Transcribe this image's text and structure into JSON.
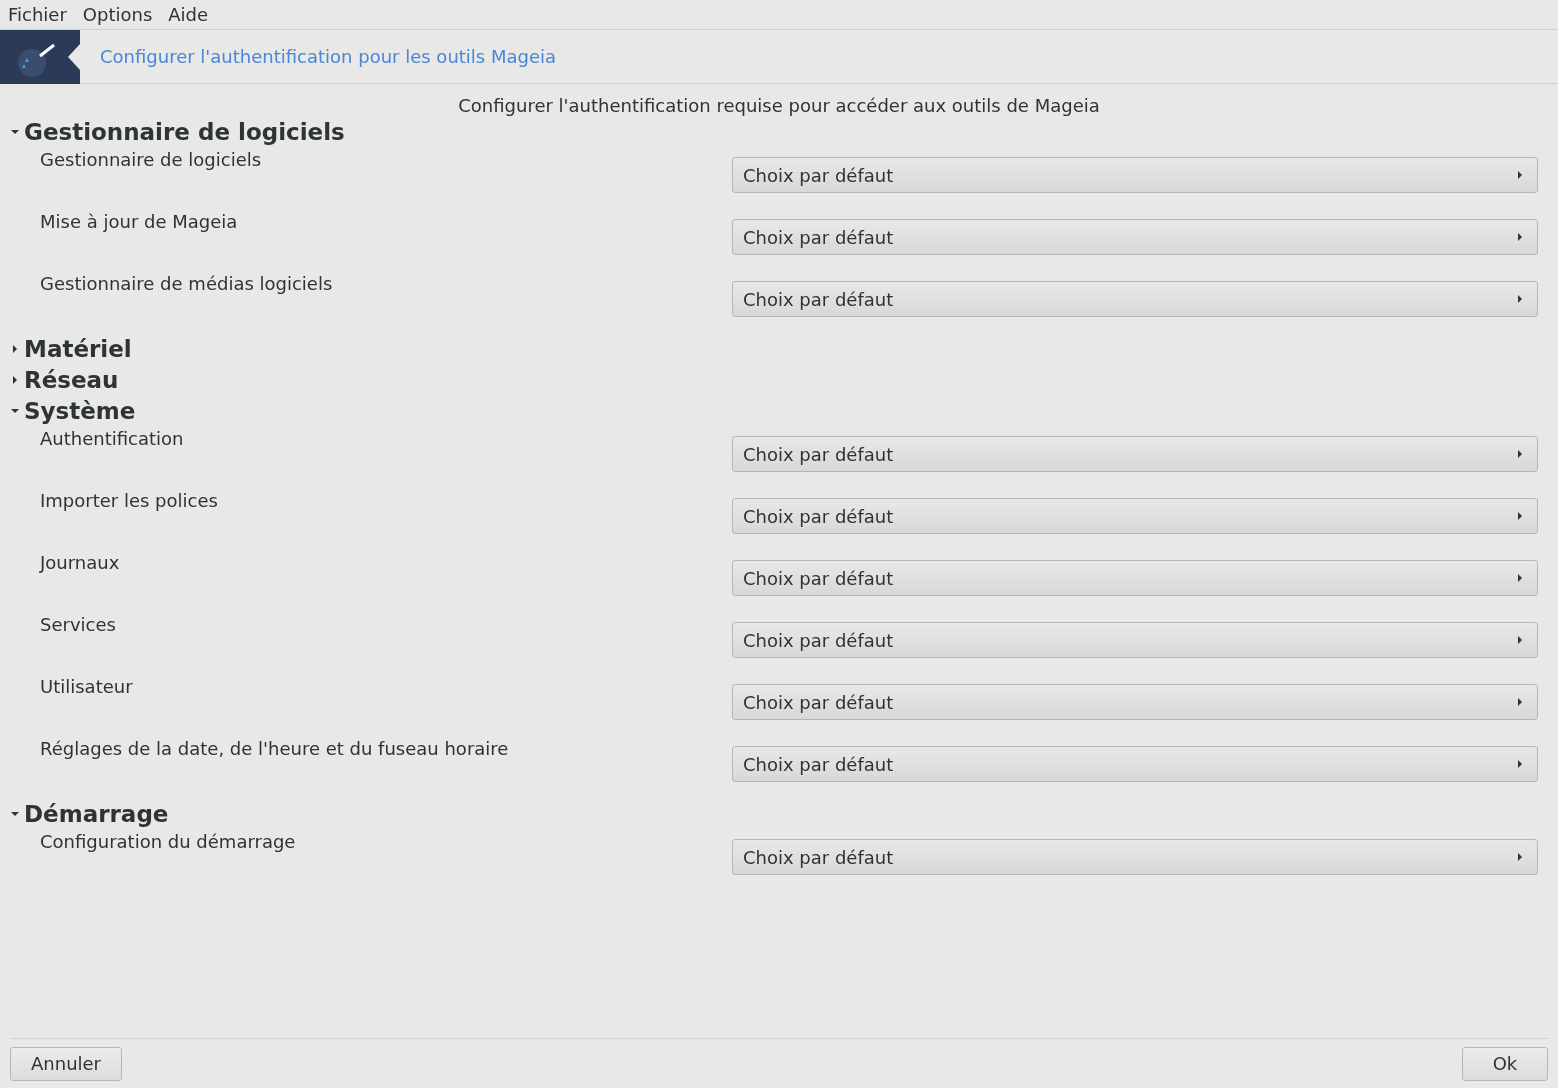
{
  "menu_bar": [
    "Fichier",
    "Options",
    "Aide"
  ],
  "header": {
    "title": "Configurer l'authentification pour les outils Mageia"
  },
  "subtitle": "Configurer l'authentification requise pour accéder aux outils de Mageia",
  "sections": [
    {
      "title": "Gestionnaire de logiciels",
      "expanded": true,
      "items": [
        {
          "label": "Gestionnaire de logiciels",
          "value": "Choix par défaut"
        },
        {
          "label": "Mise à jour de Mageia",
          "value": "Choix par défaut"
        },
        {
          "label": "Gestionnaire de médias logiciels",
          "value": "Choix par défaut"
        }
      ]
    },
    {
      "title": "Matériel",
      "expanded": false
    },
    {
      "title": "Réseau",
      "expanded": false
    },
    {
      "title": "Système",
      "expanded": true,
      "items": [
        {
          "label": "Authentification",
          "value": "Choix par défaut"
        },
        {
          "label": "Importer les polices",
          "value": "Choix par défaut"
        },
        {
          "label": "Journaux",
          "value": "Choix par défaut"
        },
        {
          "label": "Services",
          "value": "Choix par défaut"
        },
        {
          "label": "Utilisateur",
          "value": "Choix par défaut"
        },
        {
          "label": "Réglages de la date, de l'heure et du fuseau horaire",
          "value": "Choix par défaut"
        }
      ]
    },
    {
      "title": "Démarrage",
      "expanded": true,
      "items": [
        {
          "label": "Configuration du démarrage",
          "value": "Choix par défaut"
        }
      ]
    }
  ],
  "buttons": {
    "cancel": "Annuler",
    "ok": "Ok"
  }
}
